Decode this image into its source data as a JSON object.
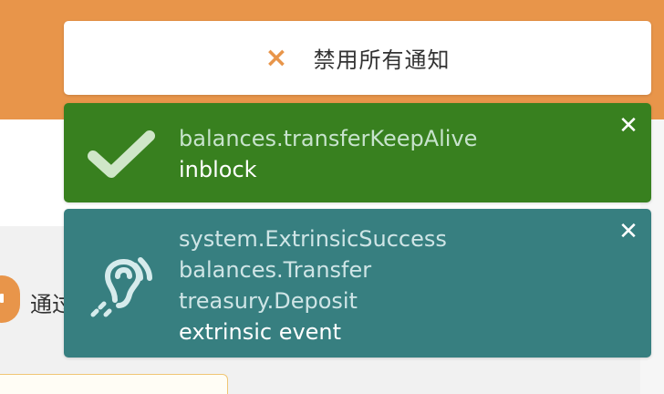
{
  "notifications": {
    "dismiss_all_label": "禁用所有通知",
    "dismiss_icon": "close-icon",
    "items": [
      {
        "icon": "checkmark-icon",
        "color": "#38801f",
        "lines": [
          "balances.transferKeepAlive"
        ],
        "status": "inblock"
      },
      {
        "icon": "ear-listen-icon",
        "color": "#377f80",
        "lines": [
          "system.ExtrinsicSuccess",
          "balances.Transfer",
          "treasury.Deposit"
        ],
        "status": "extrinsic event"
      }
    ]
  },
  "background": {
    "header_color": "#e8954a",
    "partial_text": "通过"
  }
}
